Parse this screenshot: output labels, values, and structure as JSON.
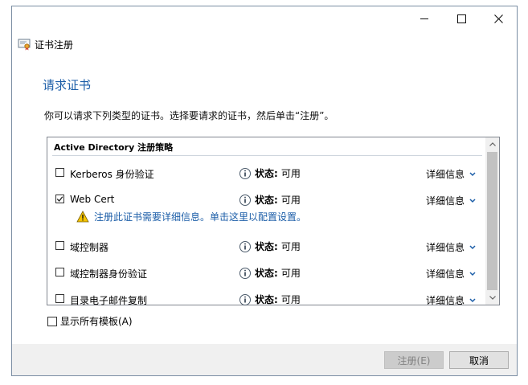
{
  "window": {
    "title": "证书注册"
  },
  "page": {
    "heading": "请求证书",
    "instruction": "你可以请求下列类型的证书。选择要请求的证书，然后单击“注册”。"
  },
  "policy_group": {
    "header": "Active Directory 注册策略",
    "status_key": "状态:",
    "details_label": "详细信息",
    "items": [
      {
        "label": "Kerberos 身份验证",
        "checked": false,
        "status": "可用"
      },
      {
        "label": "Web Cert",
        "checked": true,
        "status": "可用",
        "warning": "注册此证书需要详细信息。单击这里以配置设置。"
      },
      {
        "label": "域控制器",
        "checked": false,
        "status": "可用"
      },
      {
        "label": "域控制器身份验证",
        "checked": false,
        "status": "可用"
      },
      {
        "label": "目录电子邮件复制",
        "checked": false,
        "status": "可用"
      }
    ]
  },
  "show_all": {
    "label": "显示所有模板(A)",
    "checked": false
  },
  "buttons": {
    "register": "注册(E)",
    "cancel": "取消"
  },
  "icons": {
    "window": "certificate-icon",
    "status": "info-icon",
    "warning": "warning-icon",
    "details": "chevron-down-icon"
  },
  "colors": {
    "accent": "#1c5ea8",
    "warning": "#f5c400"
  }
}
